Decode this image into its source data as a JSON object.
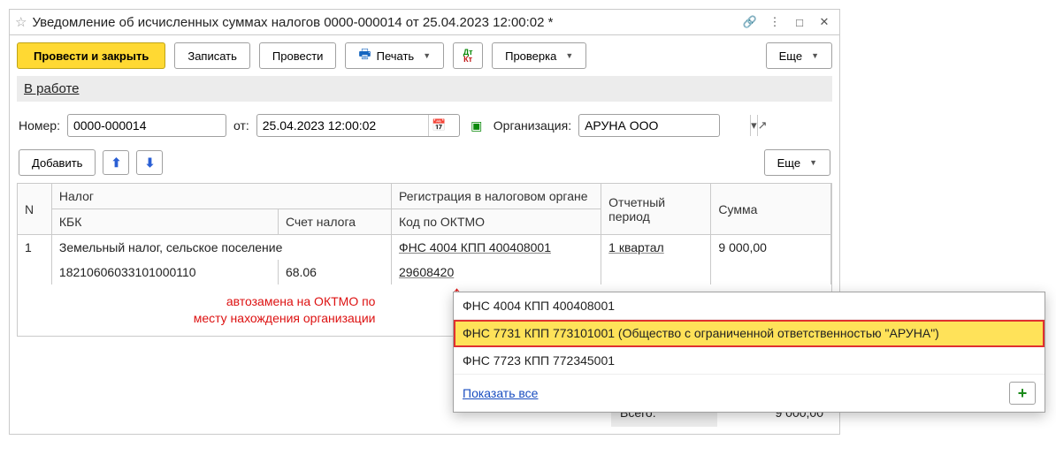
{
  "titlebar": {
    "title": "Уведомление об исчисленных суммах налогов 0000-000014 от 25.04.2023 12:00:02 *"
  },
  "toolbar": {
    "post_close": "Провести и закрыть",
    "save": "Записать",
    "post": "Провести",
    "print": "Печать",
    "check": "Проверка",
    "more": "Еще"
  },
  "status": {
    "label": "В работе"
  },
  "form": {
    "number_label": "Номер:",
    "number_value": "0000-000014",
    "from_label": "от:",
    "date_value": "25.04.2023 12:00:02",
    "org_label": "Организация:",
    "org_value": "АРУНА ООО"
  },
  "subbar": {
    "add": "Добавить",
    "more": "Еще"
  },
  "grid": {
    "headers": {
      "n": "N",
      "tax": "Налог",
      "reg": "Регистрация в налоговом органе",
      "period": "Отчетный период",
      "sum": "Сумма",
      "kbk": "КБК",
      "acc": "Счет налога",
      "oktmo": "Код по ОКТМО"
    },
    "rows": [
      {
        "n": "1",
        "tax": "Земельный налог, сельское поселение",
        "reg": "ФНС 4004 КПП 400408001",
        "period": "1 квартал",
        "sum": "9 000,00",
        "kbk": "18210606033101000110",
        "acc": "68.06",
        "oktmo": "29608420"
      }
    ]
  },
  "annotation": {
    "line1": "автозамена на ОКТМО по",
    "line2": "месту нахождения организации"
  },
  "dropdown": {
    "options": [
      "ФНС 4004 КПП 400408001",
      "ФНС 7731 КПП 773101001 (Общество с ограниченной ответственностью \"АРУНА\")",
      "ФНС 7723 КПП 772345001"
    ],
    "show_all": "Показать все"
  },
  "totals": {
    "label": "Всего:",
    "value": "9 000,00"
  }
}
